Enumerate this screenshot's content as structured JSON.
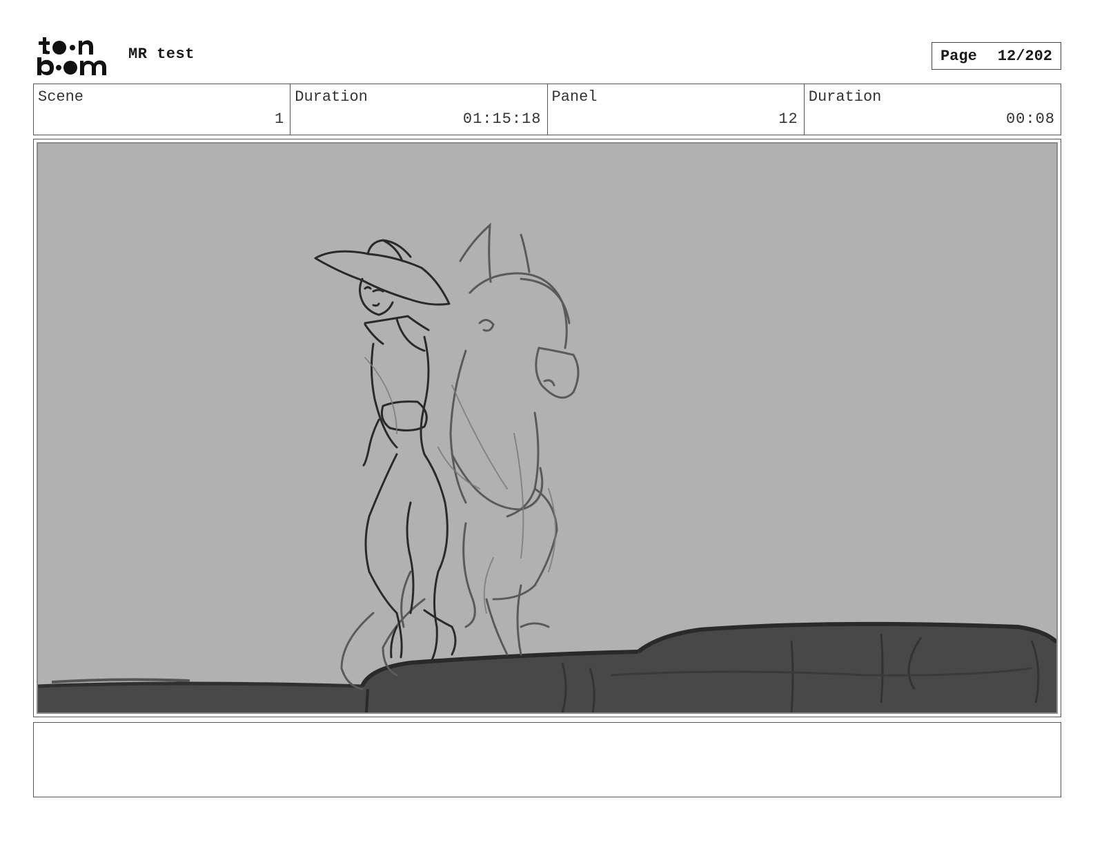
{
  "header": {
    "logo_text": "toon boom",
    "project_title": "MR test",
    "page_label": "Page",
    "page_number": "12/202"
  },
  "info": {
    "scene_label": "Scene",
    "scene_value": "1",
    "scene_duration_label": "Duration",
    "scene_duration_value": "01:15:18",
    "panel_label": "Panel",
    "panel_value": "12",
    "panel_duration_label": "Duration",
    "panel_duration_value": "00:08"
  },
  "notes": {
    "text": ""
  },
  "colors": {
    "panel_background": "#b1b1b1",
    "ground": "#484848",
    "sketch_line": "#2a2a2a"
  }
}
